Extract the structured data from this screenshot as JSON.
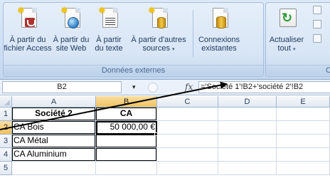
{
  "ribbon": {
    "buttons": [
      {
        "label_l1": "À partir du",
        "label_l2": "fichier Access",
        "icon": "access-database-icon"
      },
      {
        "label_l1": "À partir du",
        "label_l2": "site Web",
        "icon": "web-globe-icon"
      },
      {
        "label_l1": "À partir",
        "label_l2": "du texte",
        "icon": "text-file-icon"
      },
      {
        "label_l1": "À partir d'autres",
        "label_l2": "sources",
        "icon": "other-sources-icon",
        "dropdown": "▾"
      },
      {
        "label_l1": "Connexions",
        "label_l2": "existantes",
        "icon": "existing-connections-icon"
      },
      {
        "label_l1": "Actualiser",
        "label_l2": "tout",
        "icon": "refresh-icon",
        "dropdown": "▾"
      }
    ],
    "group_label": "Données externes",
    "second_group_label": "C"
  },
  "formula_bar": {
    "name_box": "B2",
    "name_box_dropdown": "▾",
    "fx": "fx",
    "formula": "='Société 1'!B2+'société 2'!B2"
  },
  "grid": {
    "columns": [
      "A",
      "B",
      "C",
      "D",
      "E"
    ],
    "rows": [
      "1",
      "2",
      "3",
      "4",
      "5"
    ],
    "cells": {
      "A1": "Société 2",
      "B1": "CA",
      "A2": "CA Bois",
      "B2": "50 000,00 €",
      "A3": "CA Métal",
      "A4": "CA Aluminium"
    },
    "active_cell": "B2"
  },
  "colors": {
    "ribbon_text": "#1e395b",
    "group_label": "#4a6a94",
    "header_active": "#f1c15f",
    "gridline": "#d0d7e5"
  }
}
